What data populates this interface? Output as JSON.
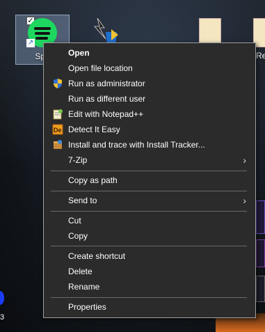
{
  "desktop": {
    "selected_icon_label": "Spo",
    "right_icon_label": "Re",
    "left_edge_number": "3"
  },
  "context_menu": {
    "items": [
      {
        "label": "Open",
        "icon": "none",
        "bold": true
      },
      {
        "label": "Open file location",
        "icon": "none"
      },
      {
        "label": "Run as administrator",
        "icon": "uac-shield-icon"
      },
      {
        "label": "Run as different user",
        "icon": "none"
      },
      {
        "label": "Edit with Notepad++",
        "icon": "notepad-plus-plus-icon"
      },
      {
        "label": "Detect It Easy",
        "icon": "detect-it-easy-icon"
      },
      {
        "label": "Install and trace with Install Tracker...",
        "icon": "install-tracker-icon"
      },
      {
        "label": "7-Zip",
        "icon": "none",
        "submenu": true
      },
      {
        "label": "Copy as path",
        "icon": "none"
      },
      {
        "label": "Send to",
        "icon": "none",
        "submenu": true
      },
      {
        "label": "Cut",
        "icon": "none"
      },
      {
        "label": "Copy",
        "icon": "none"
      },
      {
        "label": "Create shortcut",
        "icon": "none"
      },
      {
        "label": "Delete",
        "icon": "none"
      },
      {
        "label": "Rename",
        "icon": "none"
      },
      {
        "label": "Properties",
        "icon": "none"
      }
    ],
    "submenu_arrow": "›"
  },
  "colors": {
    "menu_bg": "#2b2b2b",
    "menu_border": "#a0a0a0",
    "menu_text": "#ffffff",
    "separator": "#6a6a6a",
    "spotify_green": "#1ed760"
  }
}
